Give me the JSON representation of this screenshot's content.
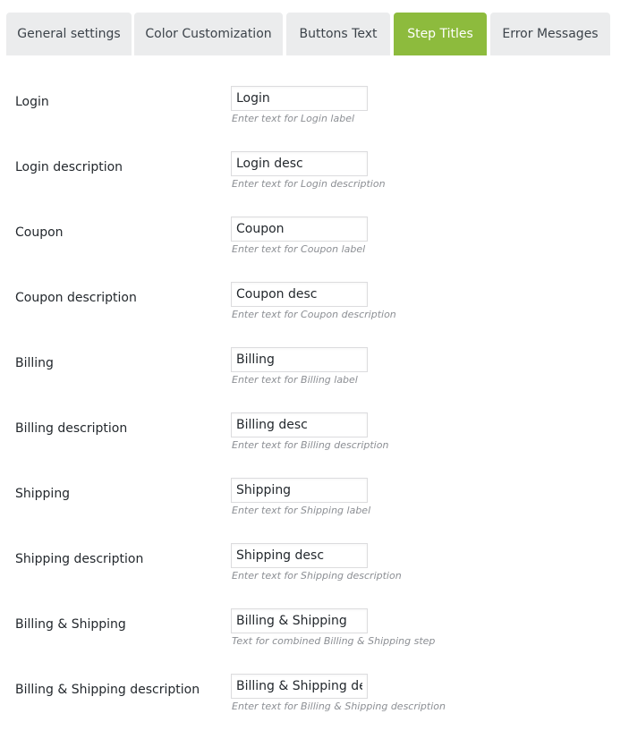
{
  "colors": {
    "accent": "#8dbb3d"
  },
  "tabs": [
    {
      "label": "General settings",
      "active": false
    },
    {
      "label": "Color Customization",
      "active": false
    },
    {
      "label": "Buttons Text",
      "active": false
    },
    {
      "label": "Step Titles",
      "active": true
    },
    {
      "label": "Error Messages",
      "active": false
    }
  ],
  "fields": [
    {
      "label": "Login",
      "value": "Login",
      "description": "Enter text for Login label"
    },
    {
      "label": "Login description",
      "value": "Login desc",
      "description": "Enter text for Login description"
    },
    {
      "label": "Coupon",
      "value": "Coupon",
      "description": "Enter text for Coupon label"
    },
    {
      "label": "Coupon description",
      "value": "Coupon desc",
      "description": "Enter text for Coupon description"
    },
    {
      "label": "Billing",
      "value": "Billing",
      "description": "Enter text for Billing label"
    },
    {
      "label": "Billing description",
      "value": "Billing desc",
      "description": "Enter text for Billing description"
    },
    {
      "label": "Shipping",
      "value": "Shipping",
      "description": "Enter text for Shipping label"
    },
    {
      "label": "Shipping description",
      "value": "Shipping desc",
      "description": "Enter text for Shipping description"
    },
    {
      "label": "Billing & Shipping",
      "value": "Billing & Shipping",
      "description": "Text for combined Billing & Shipping step"
    },
    {
      "label": "Billing & Shipping description",
      "value": "Billing & Shipping desc",
      "description": "Enter text for Billing & Shipping description"
    }
  ]
}
